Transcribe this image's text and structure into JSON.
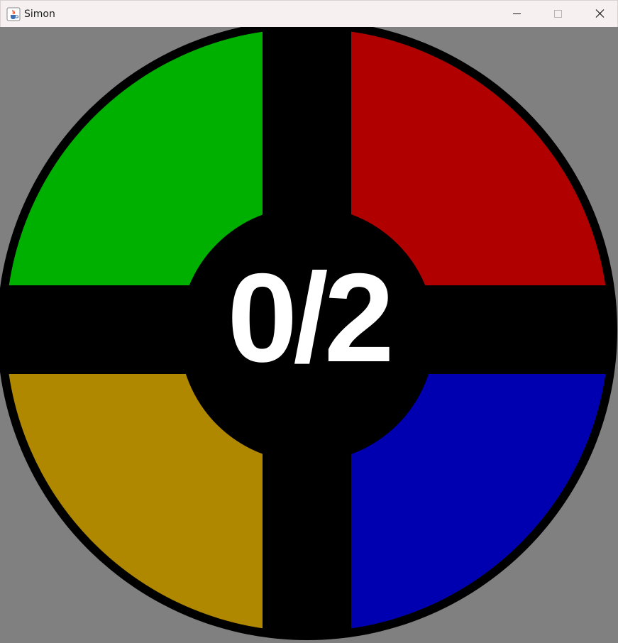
{
  "window": {
    "title": "Simon",
    "icon": "java-cup-icon",
    "controls": [
      "minimize-icon",
      "maximize-icon",
      "close-icon"
    ]
  },
  "game": {
    "score_text": "0/2",
    "background_color": "#808080",
    "ring_color": "#000000",
    "pads": [
      {
        "name": "green",
        "color": "#00b000"
      },
      {
        "name": "red",
        "color": "#b00000"
      },
      {
        "name": "yellow",
        "color": "#b08800"
      },
      {
        "name": "blue",
        "color": "#0000b0"
      }
    ]
  }
}
